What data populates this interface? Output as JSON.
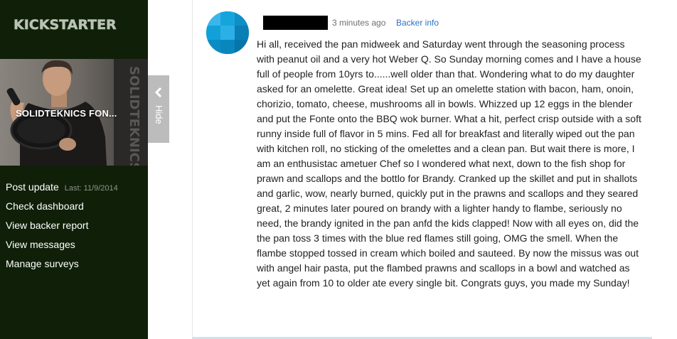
{
  "brand": {
    "logo_text": "KICKSTARTER",
    "sidebar_bg": "#102008",
    "logo_color": "#b9c2b5"
  },
  "project": {
    "title": "SOLIDTEKNICS FON..."
  },
  "nav": {
    "items": [
      {
        "label": "Post update",
        "meta": "Last: 11/9/2014"
      },
      {
        "label": "Check dashboard"
      },
      {
        "label": "View backer report"
      },
      {
        "label": "View messages"
      },
      {
        "label": "Manage surveys"
      }
    ]
  },
  "hide_tab": {
    "label": "Hide",
    "icon": "chevron-left-icon"
  },
  "comment": {
    "timestamp": "3 minutes ago",
    "backer_info_label": "Backer info",
    "link_color": "#2a72c8",
    "body": "Hi all, received the pan midweek and Saturday went through the seasoning process with peanut oil and a very hot Weber Q. So Sunday morning comes and I have a house full of people from 10yrs to......well older than that. Wondering what to do my daughter asked for an omelette. Great idea! Set up an omelette station with bacon, ham, onoin, chorizio, tomato, cheese, mushrooms all in bowls. Whizzed up 12 eggs in the blender and put the Fonte onto the BBQ wok burner. What a hit, perfect crisp outside with a soft runny inside full of flavor in 5 mins. Fed all for breakfast and literally wiped out the pan with kitchen roll, no sticking of the omelettes and a clean pan. But wait there is more, I am an enthusistac ametuer Chef so I wondered what next, down to the fish shop for prawn and scallops and the bottlo for Brandy. Cranked up the skillet and put in shallots and garlic, wow, nearly burned, quickly put in the prawns and scallops and they seared great, 2 minutes later poured on brandy with a lighter handy to flambe, seriously no need, the brandy ignited in the pan anfd the kids clapped! Now with all eyes on, did the the pan toss 3 times with the blue red flames still going, OMG the smell. When the flambe stopped tossed in cream which boiled and sauteed. By now the missus was out with angel hair pasta, put the flambed prawns and scallops in a bowl and watched as yet again from 10 to older ate every single bit. Congrats guys, you made my Sunday!"
  }
}
